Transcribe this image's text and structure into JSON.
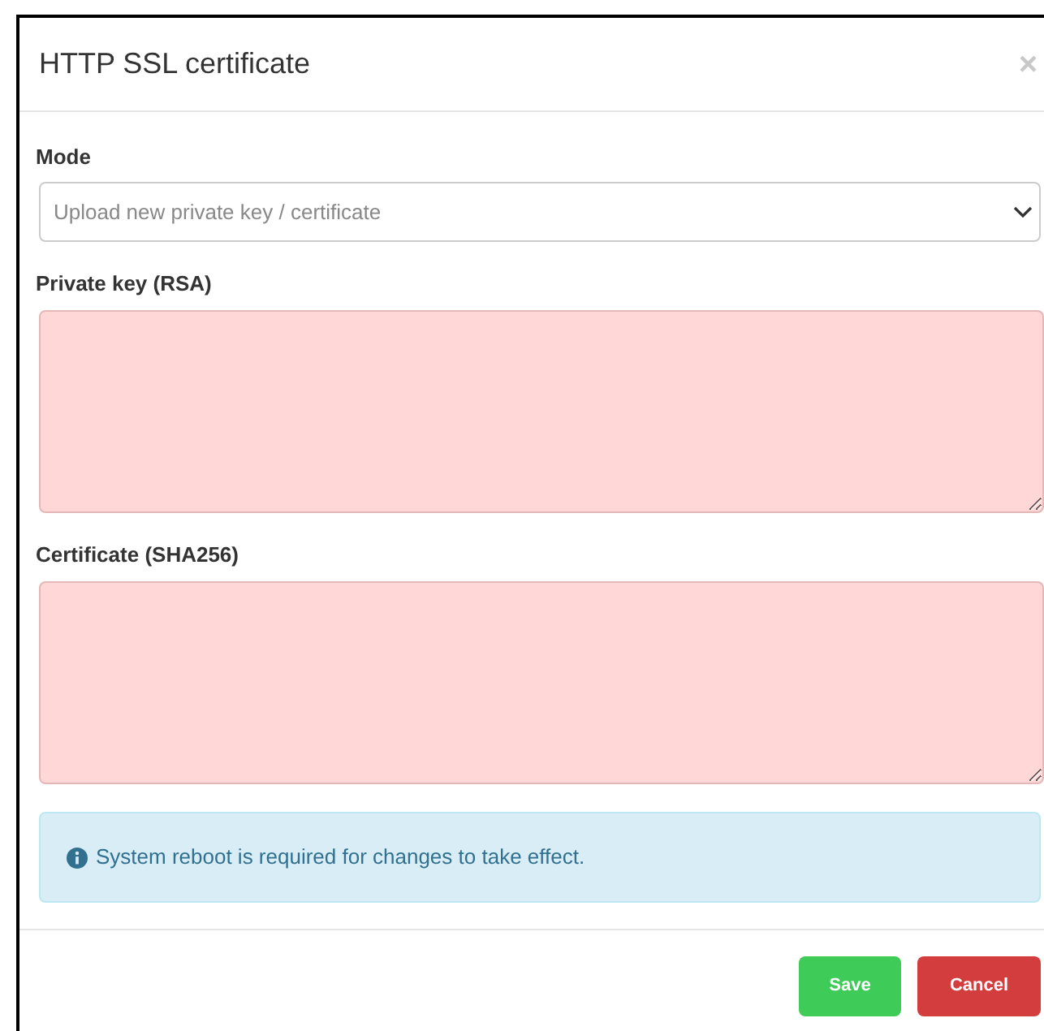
{
  "dialog": {
    "title": "HTTP SSL certificate",
    "close": "×"
  },
  "mode": {
    "label": "Mode",
    "value": "Upload new private key / certificate"
  },
  "fields": [
    {
      "label": "Private key (RSA)",
      "invalid": true
    },
    {
      "label": "Certificate (SHA256)",
      "invalid": true
    }
  ],
  "notice": {
    "text": "System reboot is required for changes to take effect."
  },
  "buttons": [
    {
      "label": "Save",
      "kind": "save"
    },
    {
      "label": "Cancel",
      "kind": "cancel"
    }
  ]
}
